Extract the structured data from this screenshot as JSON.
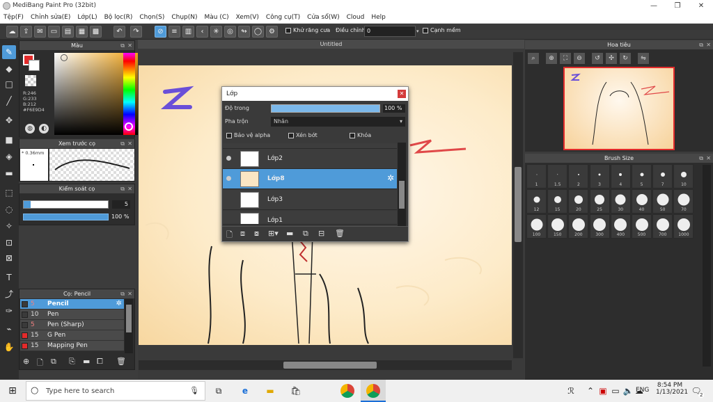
{
  "window": {
    "title": "MediBang Paint Pro (32bit)"
  },
  "menu": [
    "Tệp(F)",
    "Chỉnh sửa(E)",
    "Lớp(L)",
    "Bộ lọc(R)",
    "Chọn(S)",
    "Chụp(N)",
    "Màu (C)",
    "Xem(V)",
    "Công cụ(T)",
    "Cửa sổ(W)",
    "Cloud",
    "Help"
  ],
  "toolbar": {
    "antialias": "Khử răng cưa",
    "correction_label": "Điều chỉnh",
    "correction_value": "0",
    "smooth_edge": "Cạnh mềm"
  },
  "color_panel": {
    "title": "Màu",
    "r": "R:246",
    "g": "G:233",
    "b": "B:212",
    "hex": "#F6E9D4",
    "primary": "#e32b2b",
    "secondary": "#ffffff"
  },
  "preview_panel": {
    "title": "Xem trước cọ",
    "size": "* 0.36mm"
  },
  "brush_control": {
    "title": "Kiểm soát cọ",
    "size_value": "5",
    "opacity": "100 %"
  },
  "brush_list": {
    "title": "Cọ: Pencil",
    "items": [
      {
        "size": "5",
        "name": "Pencil",
        "color": "#3a3a3a",
        "sel": true
      },
      {
        "size": "10",
        "name": "Pen",
        "color": "#3a3a3a"
      },
      {
        "size": "5",
        "name": "Pen (Sharp)",
        "color": "#3a3a3a"
      },
      {
        "size": "15",
        "name": "G Pen",
        "color": "#e32b2b"
      },
      {
        "size": "15",
        "name": "Mapping Pen",
        "color": "#e32b2b"
      }
    ]
  },
  "document": {
    "tab": "Untitled"
  },
  "layers": {
    "title": "Lớp",
    "opacity_label": "Độ trong",
    "opacity_value": "100 %",
    "blend_label": "Pha trộn",
    "blend_value": "Nhân",
    "protect_alpha": "Bảo vệ alpha",
    "clipping": "Xén bớt",
    "lock": "Khóa",
    "rows": [
      {
        "name": "Lớp2"
      },
      {
        "name": "Lớp8",
        "sel": true
      },
      {
        "name": "Lớp3"
      },
      {
        "name": "Lớp1"
      }
    ]
  },
  "navigator": {
    "title": "Hoa tiêu"
  },
  "brush_size": {
    "title": "Brush Size",
    "sizes": [
      "1",
      "1.5",
      "2",
      "3",
      "4",
      "5",
      "7",
      "10",
      "12",
      "15",
      "20",
      "25",
      "30",
      "40",
      "50",
      "70",
      "100",
      "150",
      "200",
      "300",
      "400",
      "500",
      "700",
      "1000"
    ]
  },
  "taskbar": {
    "search_placeholder": "Type here to search",
    "lang": "ENG",
    "time": "8:54 PM",
    "date": "1/13/2021",
    "notif": "2"
  }
}
